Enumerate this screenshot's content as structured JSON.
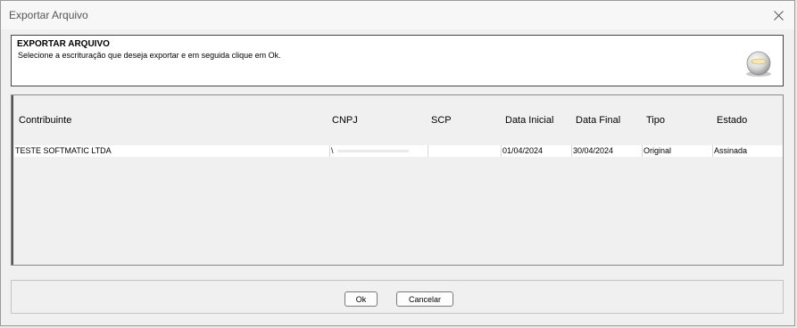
{
  "window": {
    "title": "Exportar Arquivo"
  },
  "header": {
    "title": "EXPORTAR ARQUIVO",
    "description": "Selecione a escrituração que deseja exportar e em seguida clique em Ok.",
    "icon": "disc-export-icon"
  },
  "table": {
    "columns": [
      "Contribuinte",
      "CNPJ",
      "SCP",
      "Data Inicial",
      "Data Final",
      "Tipo",
      "Estado"
    ],
    "rows": [
      {
        "contribuinte": "TESTE SOFTMATIC LTDA",
        "cnpj": "\\",
        "scp": "",
        "data_inicial": "01/04/2024",
        "data_final": "30/04/2024",
        "tipo": "Original",
        "estado": "Assinada"
      }
    ]
  },
  "footer": {
    "ok_label": "Ok",
    "cancel_label": "Cancelar"
  }
}
